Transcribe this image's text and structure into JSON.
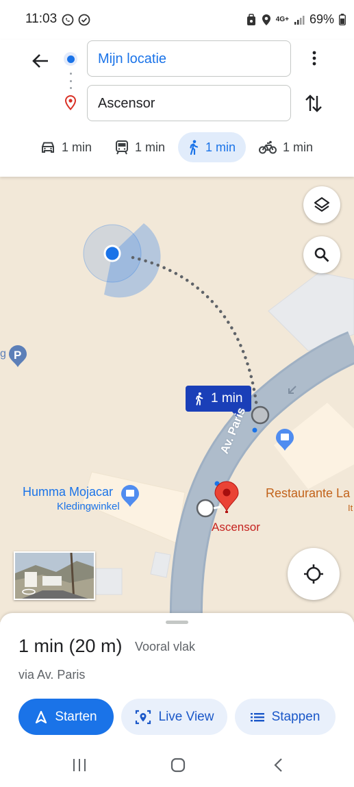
{
  "status_bar": {
    "time": "11:03",
    "network": "4G+",
    "battery": "69%"
  },
  "directions": {
    "origin": "Mijn locatie",
    "destination": "Ascensor"
  },
  "travel_modes": [
    {
      "mode": "car",
      "label": "1 min",
      "active": false
    },
    {
      "mode": "transit",
      "label": "1 min",
      "active": false
    },
    {
      "mode": "walk",
      "label": "1 min",
      "active": true
    },
    {
      "mode": "bike",
      "label": "1 min",
      "active": false
    }
  ],
  "map": {
    "route_chip": "1 min",
    "street_name": "Av. Paris",
    "destination_pin_label": "Ascensor",
    "poi_shop_name": "Humma Mojacar",
    "poi_shop_category": "Kledingwinkel",
    "poi_restaurant_name": "Restaurante La",
    "poi_restaurant_sub": "It",
    "parking_label_fragment": "g",
    "colors": {
      "route_blue": "#1a73e8",
      "chip_blue": "#1a3fb8",
      "road": "#aab8c6",
      "land": "#f2e8d8",
      "pin_red": "#ea4335"
    }
  },
  "sheet": {
    "duration": "1 min (20 m)",
    "terrain": "Vooral vlak",
    "via": "via Av. Paris",
    "start_label": "Starten",
    "live_view_label": "Live View",
    "steps_label": "Stappen"
  }
}
